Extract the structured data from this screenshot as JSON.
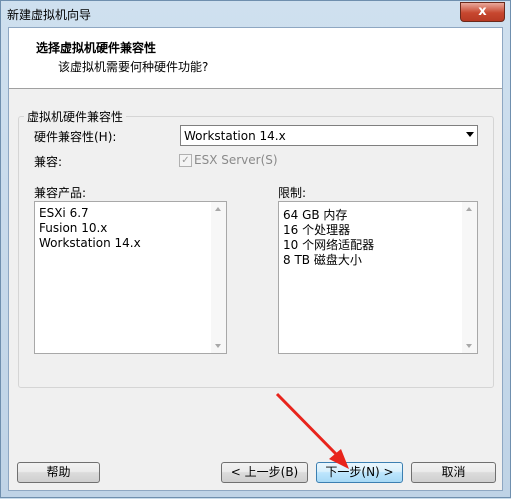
{
  "window": {
    "title": "新建虚拟机向导",
    "close_label": "x"
  },
  "header": {
    "title": "选择虚拟机硬件兼容性",
    "subtitle": "该虚拟机需要何种硬件功能?"
  },
  "group": {
    "legend": "虚拟机硬件兼容性"
  },
  "hardware_compat": {
    "label": "硬件兼容性(H):",
    "value": "Workstation 14.x"
  },
  "compatible": {
    "label": "兼容:",
    "checkbox_label": "ESX Server(S)",
    "checked": true
  },
  "compatible_products": {
    "label": "兼容产品:",
    "items": [
      "ESXi 6.7",
      "Fusion 10.x",
      "Workstation 14.x"
    ]
  },
  "limits": {
    "label": "限制:",
    "items": [
      "64 GB 内存",
      "16 个处理器",
      "10 个网络适配器",
      "8 TB 磁盘大小"
    ]
  },
  "buttons": {
    "help": "帮助",
    "back": "< 上一步(B)",
    "next": "下一步(N) >",
    "cancel": "取消"
  },
  "annotation": {
    "color": "#e8241c"
  }
}
